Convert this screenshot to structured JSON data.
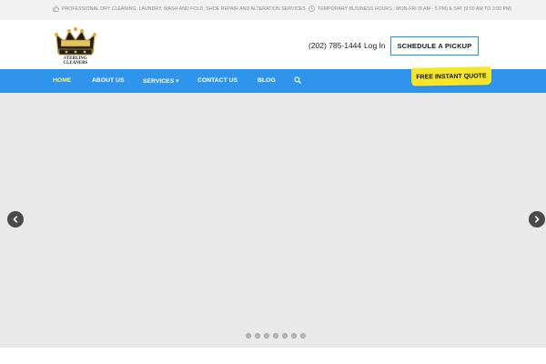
{
  "topbar": {
    "services_text": "Professional dry cleaning, laundry, wash and fold, shoe repair and alteration services",
    "hours_text": "Temporary business hours : Mon-Fri (8 am - 5 pm) & Sat (9:00 am to 3:00 pm)"
  },
  "header": {
    "logo_text": "STERLING CLEANERS",
    "phone": "(202) 785-1444",
    "login": "Log In",
    "pickup_button": "Schedule a Pickup"
  },
  "nav": {
    "items": [
      {
        "label": "Home",
        "active": true
      },
      {
        "label": "About Us"
      },
      {
        "label": "Services ▾"
      },
      {
        "label": "Contact Us"
      },
      {
        "label": "Blog"
      }
    ],
    "quote_button": "Free Instant Quote"
  },
  "colors": {
    "nav_bg": "#2f95ec",
    "accent_yellow": "#f5e62a",
    "active_link": "#f4f16a",
    "slider_bg": "#e9e9e9"
  },
  "slider": {
    "dot_count": 7
  }
}
